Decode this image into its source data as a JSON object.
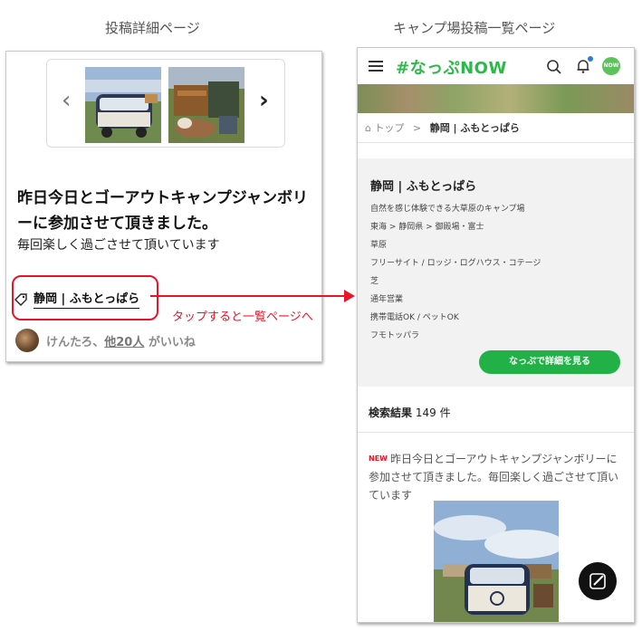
{
  "captions": {
    "left": "投稿詳細ページ",
    "right": "キャンプ場投稿一覧ページ"
  },
  "post_detail": {
    "carousel": {
      "prev_icon": "chevron-left-icon",
      "next_icon": "chevron-right-icon",
      "prev": "‹",
      "next": "›"
    },
    "title": "昨日今日とゴーアウトキャンプジャンボリーに参加させて頂きました。",
    "body": "毎回楽しく過ごさせて頂いています",
    "tag": "静岡 | ふもとっぱら",
    "likes": {
      "user": "けんたろ",
      "separator": "、",
      "others": "他20人",
      "suffix": "がいいね"
    }
  },
  "annotation": "タップすると一覧ページへ",
  "camp_list": {
    "logo": "#なっぷNOW",
    "avatar_text": "NOW",
    "breadcrumb": {
      "home": "トップ",
      "sep": ">",
      "current": "静岡 | ふもとっぱら"
    },
    "camp": {
      "name": "静岡 | ふもとっぱら",
      "lines": [
        "自然を感じ体験できる大草原のキャンプ場",
        "東海 > 静岡県 > 御殿場・富士",
        "草原",
        "フリーサイト / ロッジ・ログハウス・コテージ",
        "芝",
        "通年営業",
        "携帯電話OK / ペットOK",
        "フモトッパラ"
      ],
      "button": "なっぷで詳細を見る"
    },
    "results": {
      "label": "検索結果",
      "count": "149 件"
    },
    "card": {
      "badge": "NEW",
      "text": "昨日今日とゴーアウトキャンプジャンボリーに参加させて頂きました。毎回楽しく過ごさせて頂いています"
    }
  },
  "colors": {
    "accent_red": "#e8142a",
    "brand_green": "#22b147"
  }
}
